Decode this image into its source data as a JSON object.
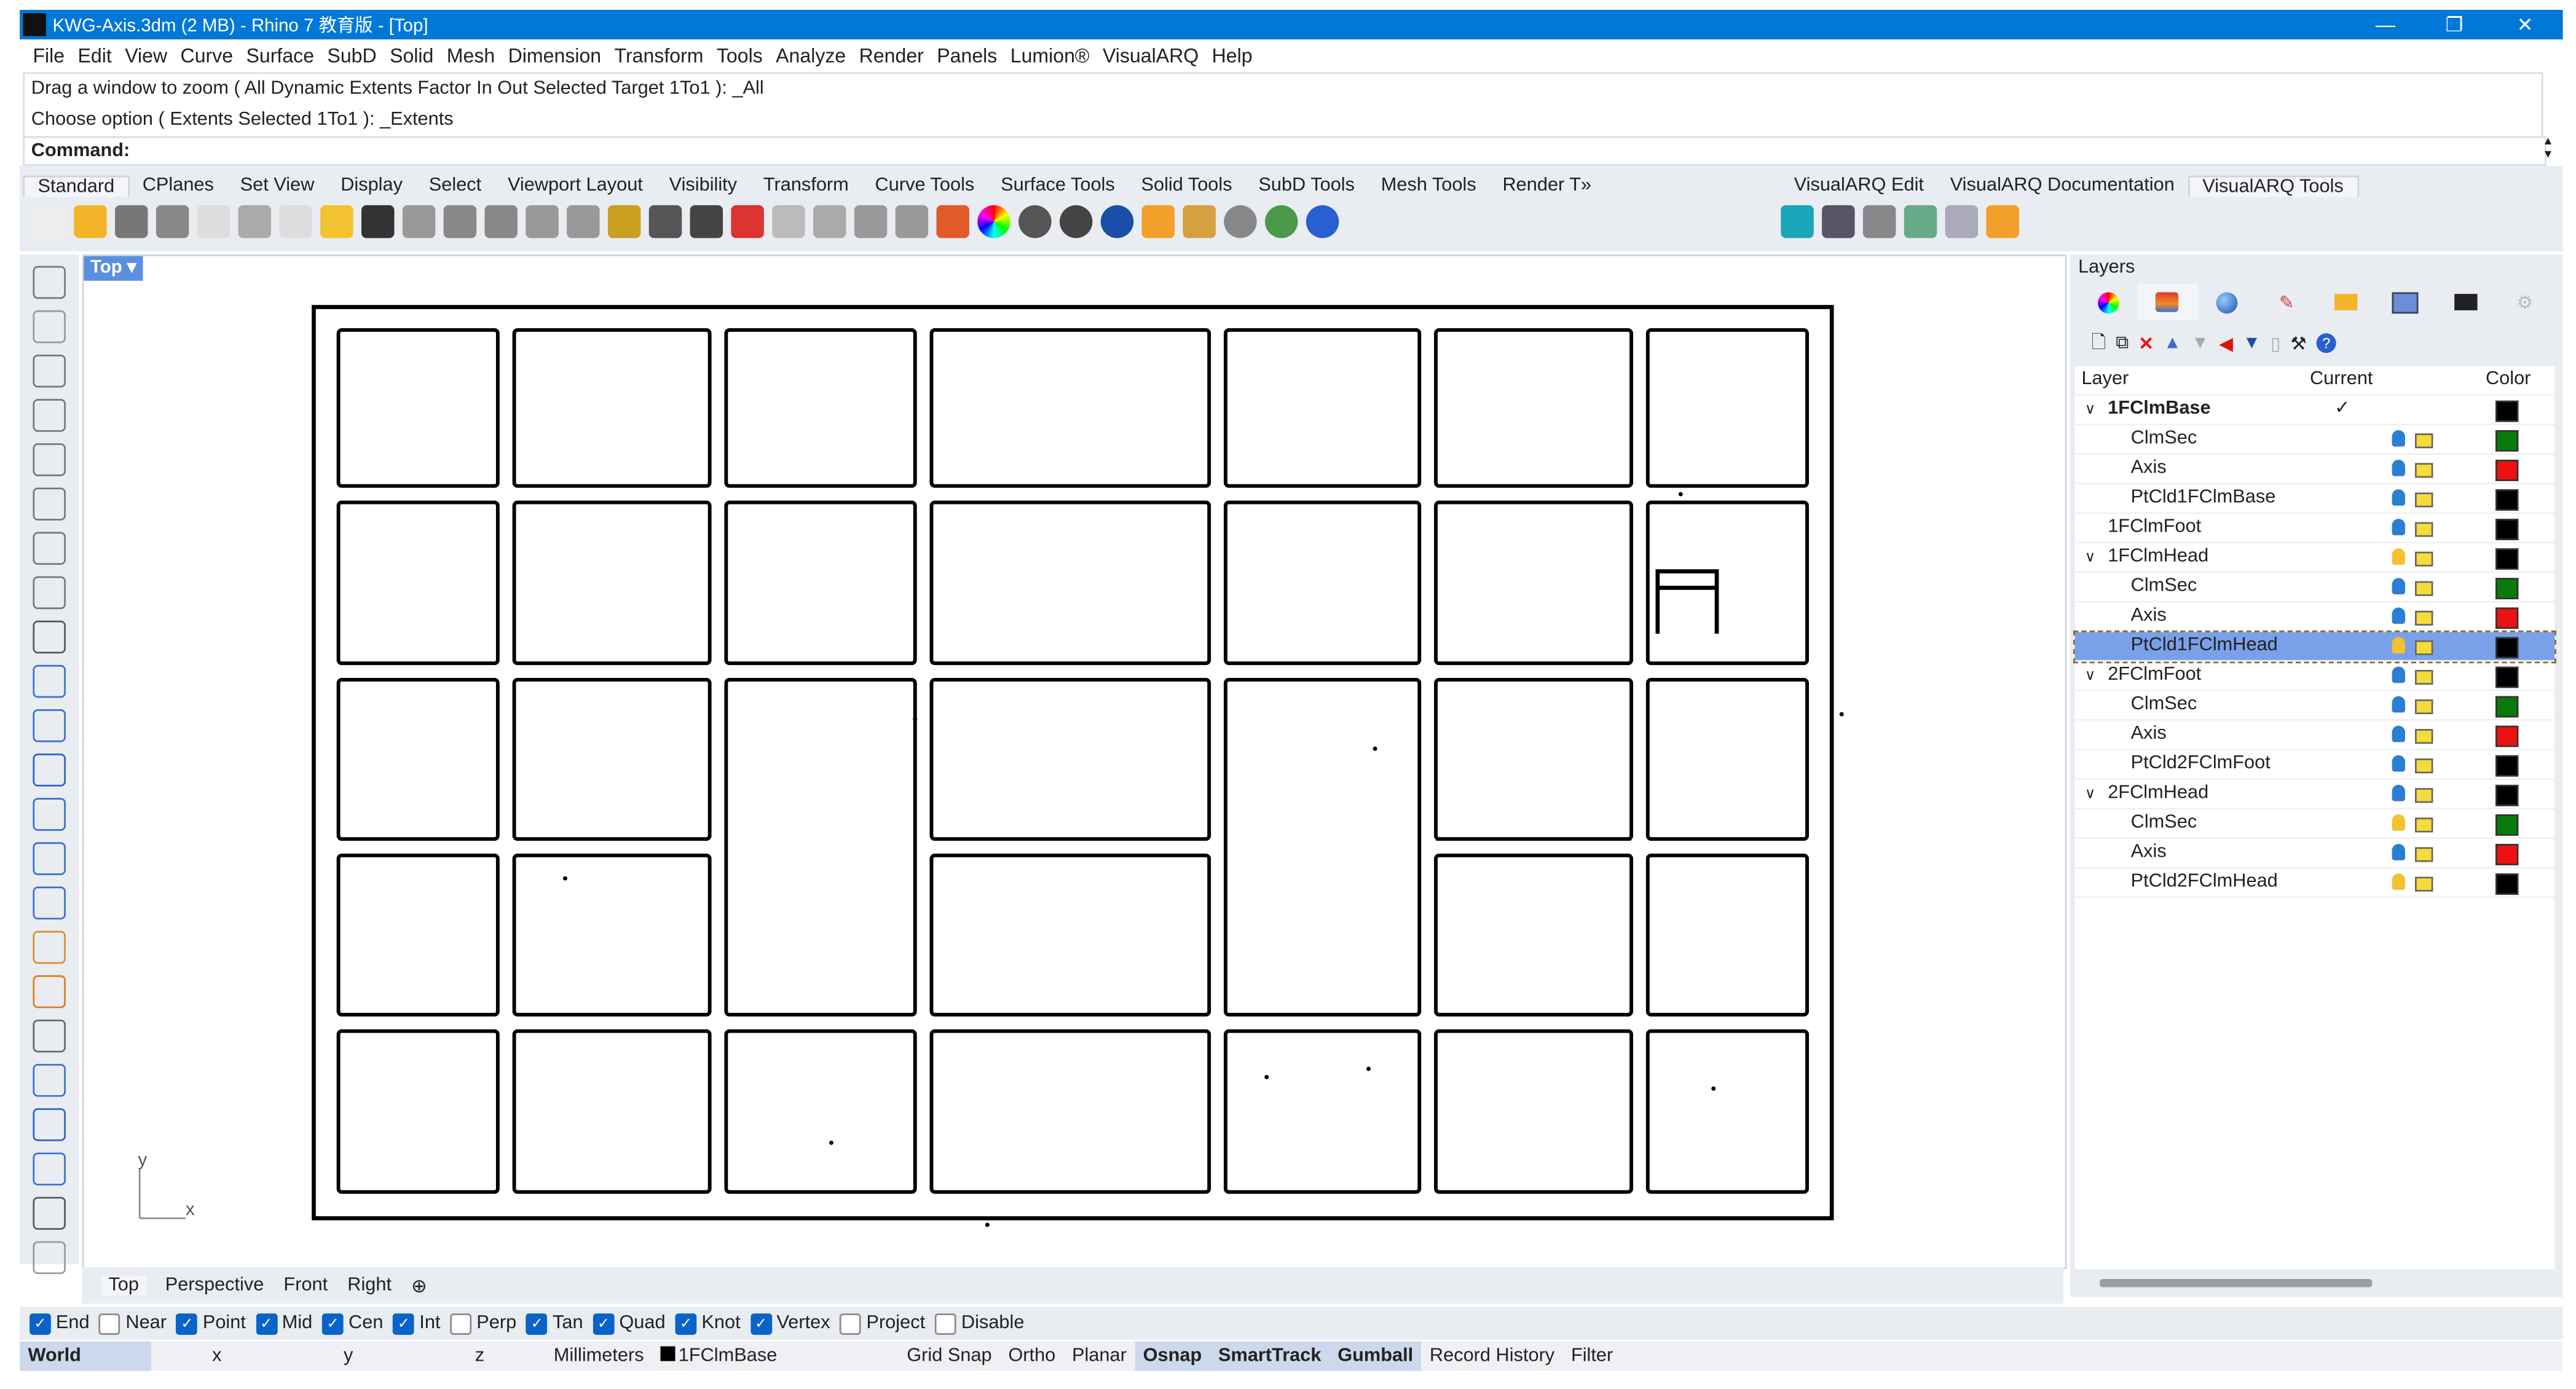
{
  "window": {
    "title": "KWG-Axis.3dm (2 MB) - Rhino 7 教育版 - [Top]",
    "minimize": "—",
    "restore": "❐",
    "close": "✕"
  },
  "menu": [
    "File",
    "Edit",
    "View",
    "Curve",
    "Surface",
    "SubD",
    "Solid",
    "Mesh",
    "Dimension",
    "Transform",
    "Tools",
    "Analyze",
    "Render",
    "Panels",
    "Lumion®",
    "VisualARQ",
    "Help"
  ],
  "command": {
    "history": [
      "Drag a window to zoom ( All  Dynamic  Extents  Factor  In  Out  Selected  Target  1To1 ): _All",
      "Choose option ( Extents  Selected  1To1 ): _Extents"
    ],
    "prompt": "Command:"
  },
  "toolbar_tabs": [
    "Standard",
    "CPlanes",
    "Set View",
    "Display",
    "Select",
    "Viewport Layout",
    "Visibility",
    "Transform",
    "Curve Tools",
    "Surface Tools",
    "Solid Tools",
    "SubD Tools",
    "Mesh Tools",
    "Render T»"
  ],
  "toolbar_tabs_right": [
    "VisualARQ Edit",
    "VisualARQ Documentation",
    "VisualARQ Tools"
  ],
  "viewport": {
    "label": "Top ▾",
    "axis_x": "x",
    "axis_y": "y"
  },
  "viewport_tabs": [
    "Top",
    "Perspective",
    "Front",
    "Right",
    "⊕"
  ],
  "osnaps": [
    {
      "label": "End",
      "on": true
    },
    {
      "label": "Near",
      "on": false
    },
    {
      "label": "Point",
      "on": true
    },
    {
      "label": "Mid",
      "on": true
    },
    {
      "label": "Cen",
      "on": true
    },
    {
      "label": "Int",
      "on": true
    },
    {
      "label": "Perp",
      "on": false
    },
    {
      "label": "Tan",
      "on": true
    },
    {
      "label": "Quad",
      "on": true
    },
    {
      "label": "Knot",
      "on": true
    },
    {
      "label": "Vertex",
      "on": true
    },
    {
      "label": "Project",
      "on": false
    },
    {
      "label": "Disable",
      "on": false
    }
  ],
  "status": {
    "cplane": "World",
    "x": "x",
    "y": "y",
    "z": "z",
    "units": "Millimeters",
    "layer": "1FClmBase",
    "toggles": [
      {
        "label": "Grid Snap",
        "on": false
      },
      {
        "label": "Ortho",
        "on": false
      },
      {
        "label": "Planar",
        "on": false
      },
      {
        "label": "Osnap",
        "on": true
      },
      {
        "label": "SmartTrack",
        "on": true
      },
      {
        "label": "Gumball",
        "on": true
      },
      {
        "label": "Record History",
        "on": false
      },
      {
        "label": "Filter",
        "on": false
      }
    ]
  },
  "layers": {
    "title": "Layers",
    "columns": {
      "layer": "Layer",
      "current": "Current",
      "color": "Color"
    },
    "rows": [
      {
        "name": "1FClmBase",
        "level": 0,
        "expand": "⌄",
        "current": true,
        "bold": true,
        "color": "#000000"
      },
      {
        "name": "ClmSec",
        "level": 1,
        "color": "#0a7a0a",
        "bulb": "#2a7fd4"
      },
      {
        "name": "Axis",
        "level": 1,
        "color": "#ee1111",
        "bulb": "#2a7fd4"
      },
      {
        "name": "PtCld1FClmBase",
        "level": 1,
        "color": "#000000",
        "bulb": "#2a7fd4"
      },
      {
        "name": "1FClmFoot",
        "level": 0,
        "color": "#000000",
        "bulb": "#2a7fd4"
      },
      {
        "name": "1FClmHead",
        "level": 0,
        "expand": "⌄",
        "color": "#000000",
        "bulb": "#f2c230"
      },
      {
        "name": "ClmSec",
        "level": 1,
        "color": "#0a7a0a",
        "bulb": "#2a7fd4"
      },
      {
        "name": "Axis",
        "level": 1,
        "color": "#ee1111",
        "bulb": "#2a7fd4"
      },
      {
        "name": "PtCld1FClmHead",
        "level": 1,
        "color": "#000000",
        "bulb": "#f2c230",
        "selected": true
      },
      {
        "name": "2FClmFoot",
        "level": 0,
        "expand": "⌄",
        "color": "#000000",
        "bulb": "#2a7fd4"
      },
      {
        "name": "ClmSec",
        "level": 1,
        "color": "#0a7a0a",
        "bulb": "#2a7fd4"
      },
      {
        "name": "Axis",
        "level": 1,
        "color": "#ee1111",
        "bulb": "#2a7fd4"
      },
      {
        "name": "PtCld2FClmFoot",
        "level": 1,
        "color": "#000000",
        "bulb": "#2a7fd4"
      },
      {
        "name": "2FClmHead",
        "level": 0,
        "expand": "⌄",
        "color": "#000000",
        "bulb": "#2a7fd4"
      },
      {
        "name": "ClmSec",
        "level": 1,
        "color": "#0a7a0a",
        "bulb": "#f2c230"
      },
      {
        "name": "Axis",
        "level": 1,
        "color": "#ee1111",
        "bulb": "#2a7fd4"
      },
      {
        "name": "PtCld2FClmHead",
        "level": 1,
        "color": "#000000",
        "bulb": "#f2c230"
      }
    ]
  },
  "colors": {
    "titlebar": "#0078d7",
    "accent": "#0a63c9",
    "selection": "#7aa0ea"
  }
}
